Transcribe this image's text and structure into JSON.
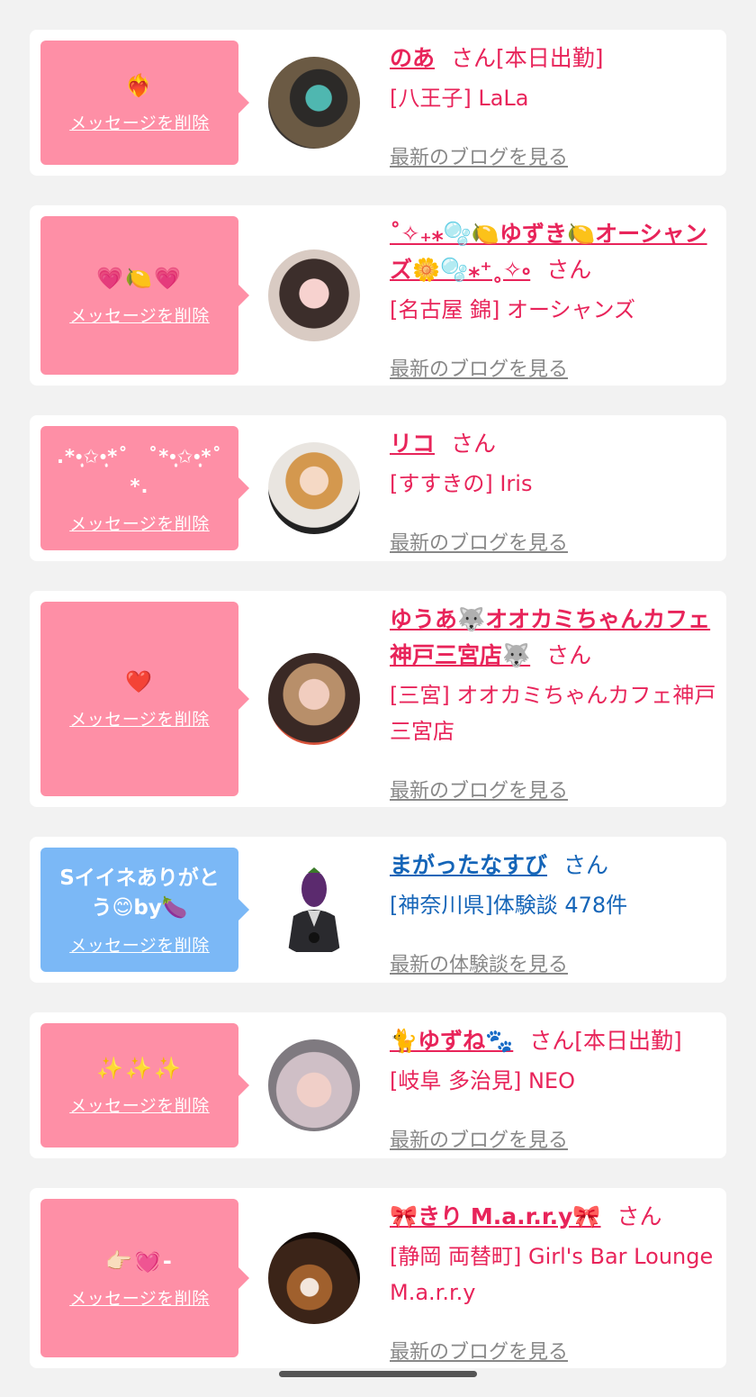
{
  "delete_label": "メッセージを削除",
  "san_label": "さん",
  "cards": [
    {
      "name": "のあ",
      "status": "[本日出勤]",
      "location": "[八王子] LaLa",
      "more": "最新のブログを見る",
      "message": "❤️‍🔥",
      "type": "cast"
    },
    {
      "name": "˚✧₊⁎🫧🍋ゆずき🍋オーシャンズ🌼🫧⁎⁺˳✧༚",
      "status": "",
      "location": "[名古屋 錦] オーシャンズ",
      "more": "最新のブログを見る",
      "message": "💗🍋💗",
      "type": "cast"
    },
    {
      "name": "リコ",
      "status": "",
      "location": "[すすきの] Iris",
      "more": "最新のブログを見る",
      "message": ".*•̩̩͙✩•̩̩͙*˚　˚*•̩̩͙✩•̩̩͙*˚*.",
      "type": "cast"
    },
    {
      "name": "ゆうあ🐺オオカミちゃんカフェ神戸三宮店🐺",
      "status": "",
      "location": "[三宮] オオカミちゃんカフェ神戸三宮店",
      "more": "最新のブログを見る",
      "message": "❤️",
      "type": "cast"
    },
    {
      "name": "まがったなすび",
      "status": "",
      "location": "[神奈川県]体験談 478件",
      "more": "最新の体験談を見る",
      "message": "Sイイネありがとう😊by🍆",
      "type": "user"
    },
    {
      "name": "🐈ゆずね🐾",
      "status": "[本日出勤]",
      "location": "[岐阜 多治見] NEO",
      "more": "最新のブログを見る",
      "message": "✨✨✨",
      "type": "cast"
    },
    {
      "name": "🎀きり M.a.r.r.y🎀",
      "status": "",
      "location": "[静岡 両替町] Girl's Bar Lounge M.a.r.r.y",
      "more": "最新のブログを見る",
      "message": "👉🏻💓-",
      "type": "cast"
    }
  ],
  "colors": {
    "pink_accent": "#e8245a",
    "blue_accent": "#1565b8",
    "bubble_pink": "#fe8fa6",
    "bubble_blue": "#7bb8f6"
  }
}
